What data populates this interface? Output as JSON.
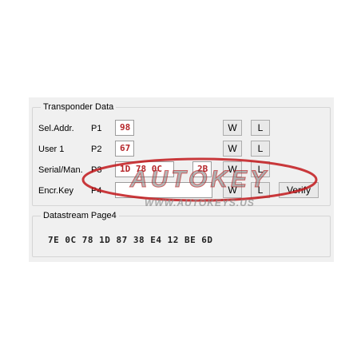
{
  "transponder": {
    "group_title": "Transponder Data",
    "rows": [
      {
        "label": "Sel.Addr.",
        "page": "P1",
        "value": "98",
        "write": "W",
        "lock": "L"
      },
      {
        "label": "User 1",
        "page": "P2",
        "value": "67",
        "write": "W",
        "lock": "L"
      },
      {
        "label": "Serial/Man.",
        "page": "P3",
        "value": "1D 78 0C",
        "extra": "2B",
        "write": "W",
        "lock": "L"
      },
      {
        "label": "Encr.Key",
        "page": "P4",
        "value": "",
        "write": "W",
        "lock": "L",
        "verify": "Verify"
      }
    ]
  },
  "datastream": {
    "group_title": "Datastream Page4",
    "bytes": "7E 0C 78 1D 87 38 E4 12 BE 6D"
  },
  "watermark": {
    "brand": "AUTOKEY",
    "url": "WWW.AUTOKEYS.US",
    "colors": {
      "red": "#c2181b",
      "grey": "#7a7a7a"
    }
  }
}
